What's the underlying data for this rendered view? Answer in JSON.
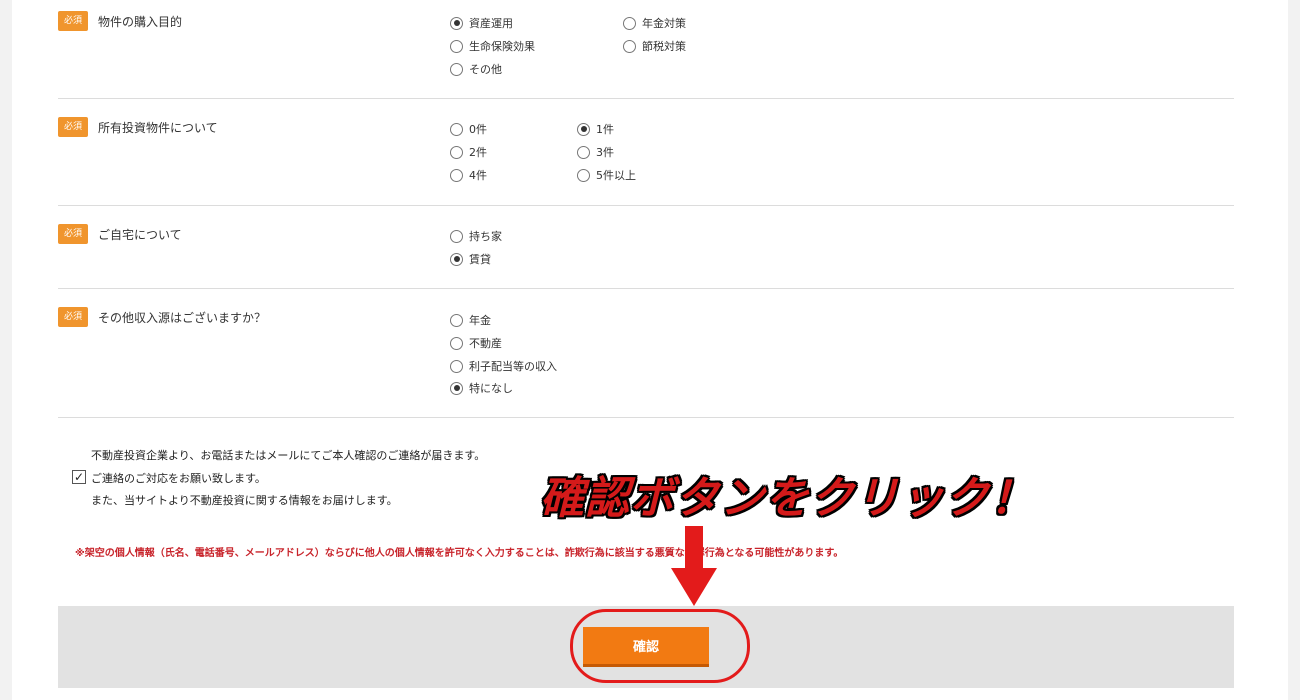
{
  "required_badge": "必須",
  "questions": [
    {
      "label": "物件の購入目的",
      "options": [
        {
          "label": "資産運用",
          "checked": true
        },
        {
          "label": "年金対策",
          "checked": false
        },
        {
          "label": "生命保険効果",
          "checked": false
        },
        {
          "label": "節税対策",
          "checked": false
        },
        {
          "label": "その他",
          "checked": false
        }
      ]
    },
    {
      "label": "所有投資物件について",
      "options": [
        {
          "label": "0件",
          "checked": false
        },
        {
          "label": "1件",
          "checked": true
        },
        {
          "label": "2件",
          "checked": false
        },
        {
          "label": "3件",
          "checked": false
        },
        {
          "label": "4件",
          "checked": false
        },
        {
          "label": "5件以上",
          "checked": false
        }
      ]
    },
    {
      "label": "ご自宅について",
      "options": [
        {
          "label": "持ち家",
          "checked": false
        },
        {
          "label": "賃貸",
          "checked": true
        }
      ]
    },
    {
      "label": "その他収入源はございますか？",
      "options": [
        {
          "label": "年金",
          "checked": false
        },
        {
          "label": "不動産",
          "checked": false
        },
        {
          "label": "利子配当等の収入",
          "checked": false
        },
        {
          "label": "特になし",
          "checked": true
        }
      ]
    }
  ],
  "consent": {
    "line1": "不動産投資企業より、お電話またはメールにてご本人確認のご連絡が届きます。",
    "line2": "ご連絡のご対応をお願い致します。",
    "line3": "また、当サイトより不動産投資に関する情報をお届けします。",
    "checked": true
  },
  "warning": "※架空の個人情報（氏名、電話番号、メールアドレス）ならびに他人の個人情報を許可なく入力することは、詐欺行為に該当する悪質な犯罪行為となる可能性があります。",
  "confirm_button": "確認",
  "annotation": "確認ボタンをクリック！",
  "colors": {
    "badge": "#f0952d",
    "button": "#f27a12",
    "warning": "#c8242b",
    "annotation": "#d41a1a"
  }
}
